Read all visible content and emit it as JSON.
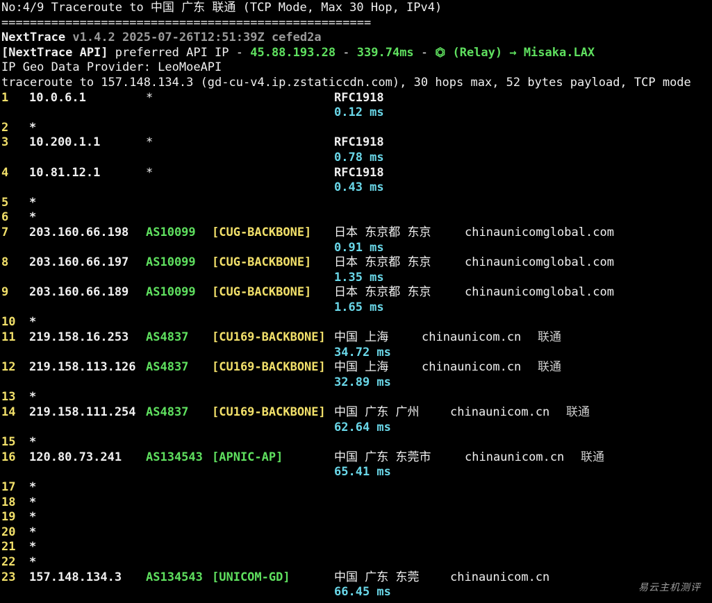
{
  "header": {
    "title": "No:4/9 Traceroute to 中国 广东 联通 (TCP Mode, Max 30 Hop, IPv4)",
    "rule": "===================================================="
  },
  "info": {
    "app_name": "NextTrace",
    "app_meta": "v1.4.2 2025-07-26T12:51:39Z cefed2a",
    "api_label": "[NextTrace API]",
    "api_text": " preferred API IP - ",
    "api_ip": "45.88.193.28",
    "api_sep1": " - ",
    "api_latency": "339.74ms",
    "api_sep2": " - ",
    "api_icon": "⏣",
    "api_relay": " (Relay) → Misaka.LAX",
    "geo_provider": "IP Geo Data Provider: LeoMoeAPI",
    "traceroute_line": "traceroute to 157.148.134.3 (gd-cu-v4.ip.zstaticcdn.com), 30 hops max, 52 bytes payload, TCP mode"
  },
  "hops": [
    {
      "hop": "1",
      "ip": "10.0.6.1",
      "as": "",
      "star2": "*",
      "tag": "",
      "geo": "RFC1918",
      "domain": "",
      "isp": "",
      "rtt": "0.12 ms"
    },
    {
      "hop": "2",
      "ip": "*",
      "rtt": ""
    },
    {
      "hop": "3",
      "ip": "10.200.1.1",
      "as": "",
      "star2": "*",
      "tag": "",
      "geo": "RFC1918",
      "domain": "",
      "isp": "",
      "rtt": "0.78 ms"
    },
    {
      "hop": "4",
      "ip": "10.81.12.1",
      "as": "",
      "star2": "*",
      "tag": "",
      "geo": "RFC1918",
      "domain": "",
      "isp": "",
      "rtt": "0.43 ms"
    },
    {
      "hop": "5",
      "ip": "*",
      "rtt": ""
    },
    {
      "hop": "6",
      "ip": "*",
      "rtt": ""
    },
    {
      "hop": "7",
      "ip": "203.160.66.198",
      "as": "AS10099",
      "star2": "",
      "tag": "[CUG-BACKBONE]",
      "geo": "日本 东京都 东京",
      "domain": "chinaunicomglobal.com",
      "isp": "",
      "rtt": "0.91 ms"
    },
    {
      "hop": "8",
      "ip": "203.160.66.197",
      "as": "AS10099",
      "star2": "",
      "tag": "[CUG-BACKBONE]",
      "geo": "日本 东京都 东京",
      "domain": "chinaunicomglobal.com",
      "isp": "",
      "rtt": "1.35 ms"
    },
    {
      "hop": "9",
      "ip": "203.160.66.189",
      "as": "AS10099",
      "star2": "",
      "tag": "[CUG-BACKBONE]",
      "geo": "日本 东京都 东京",
      "domain": "chinaunicomglobal.com",
      "isp": "",
      "rtt": "1.65 ms"
    },
    {
      "hop": "10",
      "ip": "*",
      "rtt": ""
    },
    {
      "hop": "11",
      "ip": "219.158.16.253",
      "as": "AS4837",
      "star2": "",
      "tag": "[CU169-BACKBONE]",
      "geo": "中国 上海",
      "domain": "chinaunicom.cn",
      "isp": "联通",
      "rtt": "34.72 ms"
    },
    {
      "hop": "12",
      "ip": "219.158.113.126",
      "as": "AS4837",
      "star2": "",
      "tag": "[CU169-BACKBONE]",
      "geo": "中国 上海",
      "domain": "chinaunicom.cn",
      "isp": "联通",
      "rtt": "32.89 ms"
    },
    {
      "hop": "13",
      "ip": "*",
      "rtt": ""
    },
    {
      "hop": "14",
      "ip": "219.158.111.254",
      "as": "AS4837",
      "star2": "",
      "tag": "[CU169-BACKBONE]",
      "geo": "中国 广东 广州",
      "domain": "chinaunicom.cn",
      "isp": "联通",
      "rtt": "62.64 ms"
    },
    {
      "hop": "15",
      "ip": "*",
      "rtt": ""
    },
    {
      "hop": "16",
      "ip": "120.80.73.241",
      "as": "AS134543",
      "star2": "",
      "tag": "[APNIC-AP]",
      "geo": "中国 广东 东莞市",
      "domain": "chinaunicom.cn",
      "isp": "联通",
      "rtt": "65.41 ms"
    },
    {
      "hop": "17",
      "ip": "*",
      "rtt": ""
    },
    {
      "hop": "18",
      "ip": "*",
      "rtt": ""
    },
    {
      "hop": "19",
      "ip": "*",
      "rtt": ""
    },
    {
      "hop": "20",
      "ip": "*",
      "rtt": ""
    },
    {
      "hop": "21",
      "ip": "*",
      "rtt": ""
    },
    {
      "hop": "22",
      "ip": "*",
      "rtt": ""
    },
    {
      "hop": "23",
      "ip": "157.148.134.3",
      "as": "AS134543",
      "star2": "",
      "tag": "[UNICOM-GD]",
      "geo": "中国 广东 东莞",
      "domain": "chinaunicom.cn",
      "isp": "",
      "rtt": "66.45 ms"
    }
  ],
  "watermark": "易云主机测评",
  "colors": {
    "background": "#000000",
    "text": "#f0f0f0",
    "hop_number": "#f2e06a",
    "asn": "#5fe05f",
    "backbone_tag": "#f2e06a",
    "rtt": "#6ad7e8"
  }
}
